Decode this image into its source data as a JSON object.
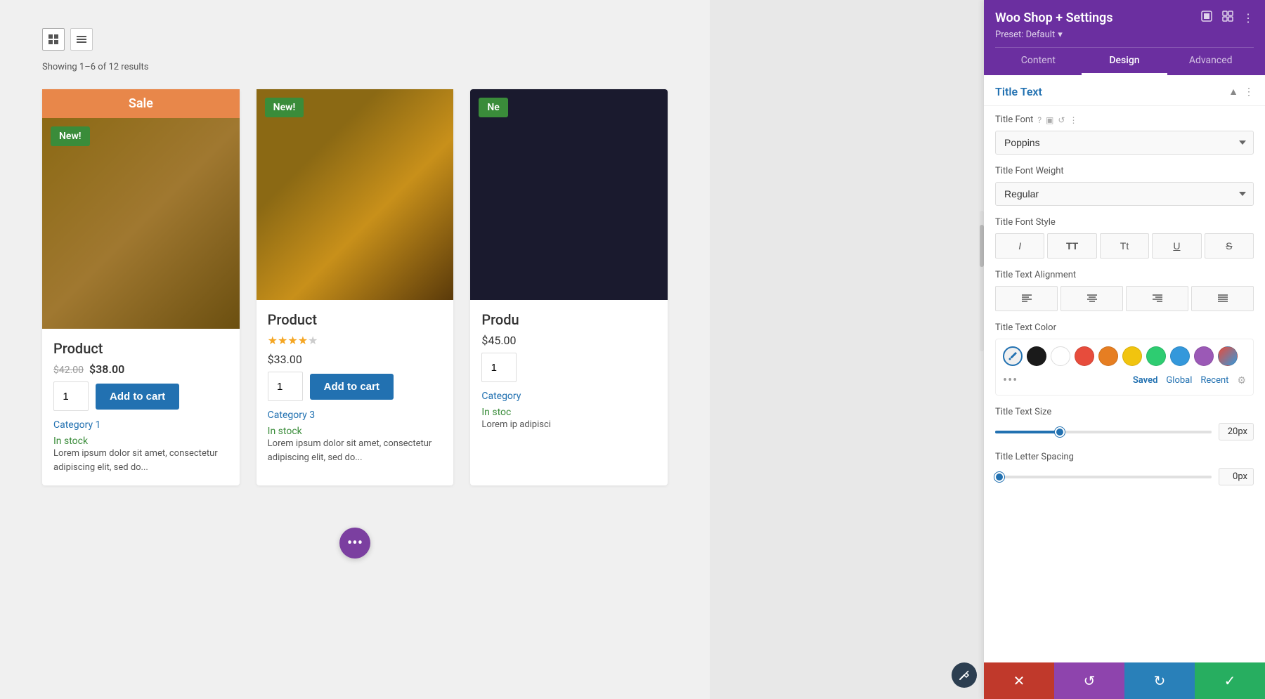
{
  "panel": {
    "title": "Woo Shop + Settings",
    "preset_label": "Preset: Default",
    "tabs": [
      {
        "id": "content",
        "label": "Content"
      },
      {
        "id": "design",
        "label": "Design"
      },
      {
        "id": "advanced",
        "label": "Advanced"
      }
    ],
    "active_tab": "design",
    "section": {
      "title": "Title Text"
    },
    "title_font": {
      "label": "Title Font",
      "value": "Poppins"
    },
    "title_font_weight": {
      "label": "Title Font Weight",
      "value": "Regular"
    },
    "title_font_style": {
      "label": "Title Font Style"
    },
    "title_text_alignment": {
      "label": "Title Text Alignment"
    },
    "title_text_color": {
      "label": "Title Text Color",
      "swatches": [
        {
          "color": "#fff",
          "type": "eyedropper"
        },
        {
          "color": "#1a1a1a"
        },
        {
          "color": "#ffffff"
        },
        {
          "color": "#e74c3c"
        },
        {
          "color": "#e67e22"
        },
        {
          "color": "#f1c40f"
        },
        {
          "color": "#2ecc71"
        },
        {
          "color": "#3498db"
        },
        {
          "color": "#9b59b6"
        },
        {
          "color": "#gradient"
        }
      ],
      "tabs": [
        "Saved",
        "Global",
        "Recent"
      ]
    },
    "title_text_size": {
      "label": "Title Text Size",
      "value": "20px",
      "percent": 30
    },
    "title_letter_spacing": {
      "label": "Title Letter Spacing",
      "value": "0px",
      "percent": 0
    }
  },
  "shop": {
    "results_text": "Showing 1–6 of 12 results",
    "products": [
      {
        "name": "Product",
        "badge": "Sale",
        "badge_type": "sale",
        "new_badge": "New!",
        "price_old": "$42.00",
        "price_new": "$38.00",
        "qty": "1",
        "add_to_cart": "Add to cart",
        "category": "Category 1",
        "stock": "In stock",
        "description": "Lorem ipsum dolor sit amet, consectetur adipiscing elit, sed do..."
      },
      {
        "name": "Product",
        "badge": "New!",
        "badge_type": "new",
        "stars": 3.5,
        "price": "$33.00",
        "qty": "1",
        "add_to_cart": "Add to cart",
        "category": "Category 3",
        "stock": "In stock",
        "description": "Lorem ipsum dolor sit amet, consectetur adipiscing elit, sed do..."
      },
      {
        "name": "Produ",
        "badge": "Ne",
        "badge_type": "new",
        "price": "$45.00",
        "qty": "1",
        "category": "Category",
        "stock": "In stoc",
        "description": "Lorem ip adipisci"
      }
    ]
  },
  "bottom_actions": {
    "cancel": "✕",
    "reset": "↺",
    "redo": "↻",
    "save": "✓"
  },
  "floating_btn": "•••",
  "color_tabs": {
    "saved": "Saved",
    "global": "Global",
    "recent": "Recent"
  },
  "font_style_buttons": [
    {
      "id": "italic",
      "symbol": "I",
      "style": "italic"
    },
    {
      "id": "uppercase",
      "symbol": "TT"
    },
    {
      "id": "capitalize",
      "symbol": "Tt"
    },
    {
      "id": "underline",
      "symbol": "U"
    },
    {
      "id": "strikethrough",
      "symbol": "S"
    }
  ],
  "alignment_buttons": [
    {
      "id": "left",
      "symbol": "≡"
    },
    {
      "id": "center",
      "symbol": "≡"
    },
    {
      "id": "right",
      "symbol": "≡"
    },
    {
      "id": "justify",
      "symbol": "≡"
    }
  ]
}
